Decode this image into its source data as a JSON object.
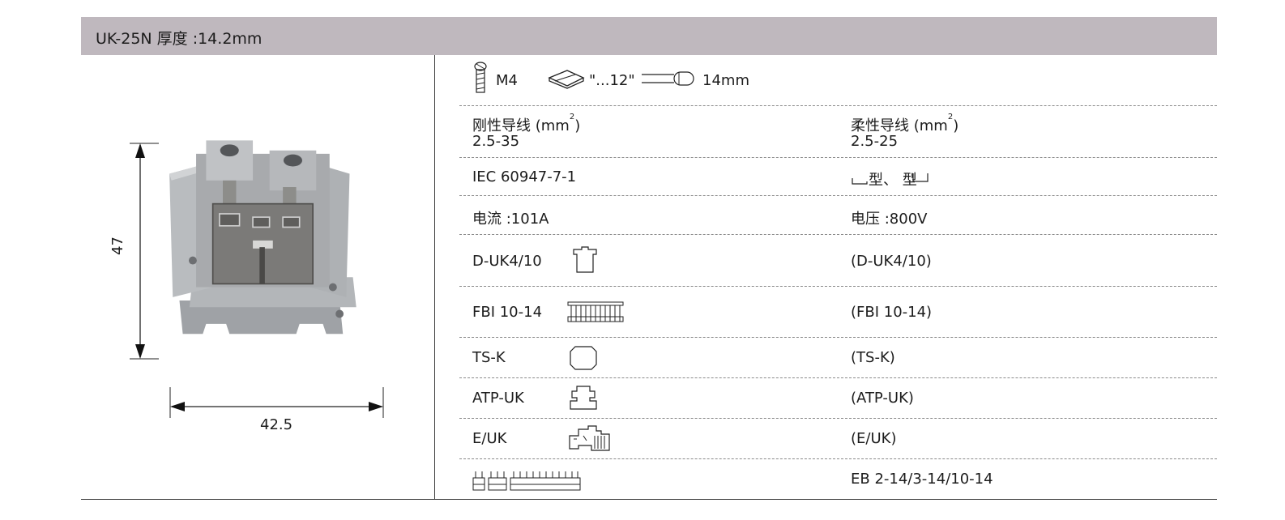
{
  "header": {
    "title": "UK-25N  厚度 :14.2mm"
  },
  "dimensions": {
    "height": "47",
    "width": "42.5"
  },
  "specs": {
    "screw_label": "M4",
    "strip_length_label": "\"...12\"",
    "wire_length_label": "14mm",
    "rigid_wire_label": "刚性导线 (mm",
    "rigid_wire_sup": "2",
    "rigid_wire_close": ")",
    "rigid_wire_value": "2.5-35",
    "flexible_wire_label": "柔性导线 (mm",
    "flexible_wire_sup": "2",
    "flexible_wire_close": ")",
    "flexible_wire_value": "2.5-25",
    "standard": "IEC 60947-7-1",
    "bridge_types": "型、 型",
    "current": "电流 :101A",
    "voltage": "电压 :800V"
  },
  "accessories": [
    {
      "left_label": "D-UK4/10",
      "right_label": "(D-UK4/10)",
      "icon": "end-cover-icon"
    },
    {
      "left_label": "FBI 10-14",
      "right_label": "(FBI 10-14)",
      "icon": "fixed-bridge-icon"
    },
    {
      "left_label": "TS-K",
      "right_label": "(TS-K)",
      "icon": "cover-cap-icon"
    },
    {
      "left_label": "ATP-UK",
      "right_label": "(ATP-UK)",
      "icon": "partition-plate-icon"
    },
    {
      "left_label": "E/UK",
      "right_label": "(E/UK)",
      "icon": "end-bracket-icon"
    },
    {
      "left_label": "",
      "right_label": "EB 2-14/3-14/10-14",
      "icon": "insertion-bridges-icon"
    }
  ],
  "colors": {
    "header_bg": "#bfb8be",
    "terminal_body": "#a8aaad",
    "metal_plate": "#7b7a78"
  }
}
